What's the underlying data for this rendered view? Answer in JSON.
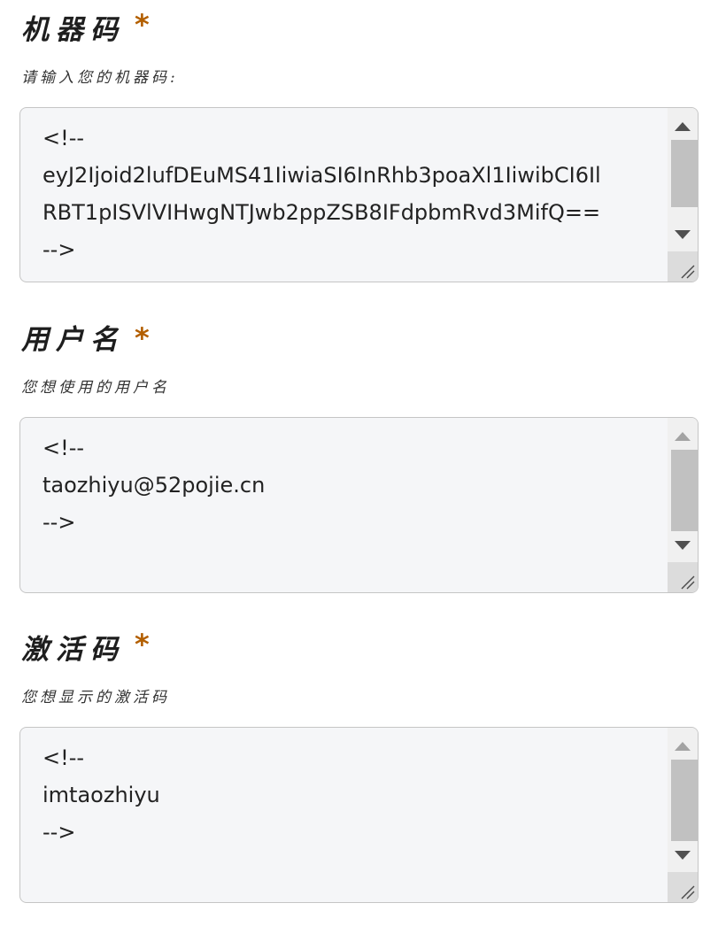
{
  "fields": [
    {
      "label": "机器码",
      "required_mark": "*",
      "hint": "请输入您的机器码:",
      "value_lines": [
        "<!--",
        "eyJ2Ijoid2lufDEuMS41IiwiaSI6InRhb3poaXl1IiwibCI6Il",
        "RBT1pISVlVIHwgNTJwb2ppZSB8IFdpbmRvd3MifQ==",
        "-->"
      ]
    },
    {
      "label": "用户名",
      "required_mark": "*",
      "hint": "您想使用的用户名",
      "value_lines": [
        "<!--",
        "taozhiyu@52pojie.cn",
        "-->"
      ]
    },
    {
      "label": "激活码",
      "required_mark": "*",
      "hint": "您想显示的激活码",
      "value_lines": [
        "<!--",
        "imtaozhiyu",
        "-->"
      ]
    }
  ],
  "colors": {
    "required_mark": "#b35f00",
    "textarea_bg": "#f5f6f8",
    "textarea_border": "#c5c5c5",
    "scroll_thumb": "#c1c1c1"
  },
  "icons": {
    "scroll_up": "triangle-up-icon",
    "scroll_down": "triangle-down-icon",
    "resize": "resize-grip-icon"
  }
}
